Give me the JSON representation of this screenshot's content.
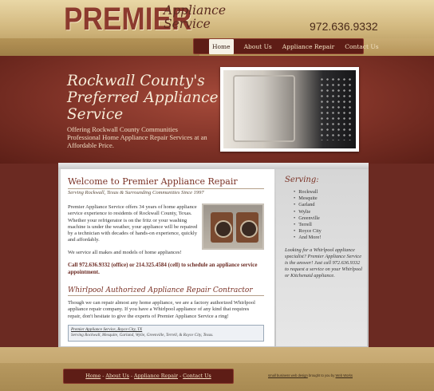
{
  "header": {
    "logo_main": "PREMIER",
    "logo_sub": "Appliance Service",
    "phone": "972.636.9332"
  },
  "nav": {
    "items": [
      "Home",
      "About Us",
      "Appliance Repair",
      "Contact Us"
    ],
    "active": "Home"
  },
  "hero": {
    "title": "Rockwall County's Preferred Appliance Service",
    "text": "Offering Rockwall County Communities Professional Home Appliance Repair Services at an Affordable Price."
  },
  "main": {
    "welcome_title": "Welcome to Premier Appliance Repair",
    "serving_line": "Serving Rockwall, Texas & Surrounding Communities Since 1997",
    "p1": "Premier Appliance Service offers 34 years of home appliance service experience to residents of Rockwall County, Texas. Whether your refrigerator is on the fritz or your washing machine is under the weather, your appliance will be repaired by a technician with decades of hands-on experience, quickly and affordably.",
    "p2": "We service all makes and models of home appliances!",
    "p3": "Call 972.636.9332 (office) or 214.325.4584 (cell) to schedule an appliance service appointment.",
    "whirlpool_title": "Whirlpool Authorized Appliance Repair Contractor",
    "p4": "Though we can repair almost any home appliance, we are a factory authorized Whirlpool appliance repair company. If you have a Whirlpool appliance of any kind that requires repair, don't hesitate to give the experts of Premier Appliance Service a ring!",
    "addr_link": "Premier Appliance Service, Royce City, TX",
    "addr_line": "Serving Rockwall, Mesquite, Garland, Wylie, Greenville, Terrell, & Royce City, Texas."
  },
  "sidebar": {
    "title": "Serving:",
    "cities": [
      "Rockwall",
      "Mesquite",
      "Garland",
      "Wylie",
      "Greenville",
      "Terrell",
      "Royce City",
      "And More!"
    ],
    "text": "Looking for a Whirlpool appliance specialist? Premier Appliance Service is the answer! Just call 972.636.9332 to request a service on your Whirlpool or Kitchenaid appliance."
  },
  "footer": {
    "links": [
      "Home",
      "About Us",
      "Appliance Repair",
      "Contact Us"
    ],
    "sep": "-",
    "credit_link": "small business web design",
    "credit_mid": " brought to you by ",
    "credit_link2": "Web Works"
  },
  "colors": {
    "brand_red": "#7a3125",
    "nav_bg": "#5e1d16",
    "gold": "#d3b980"
  }
}
